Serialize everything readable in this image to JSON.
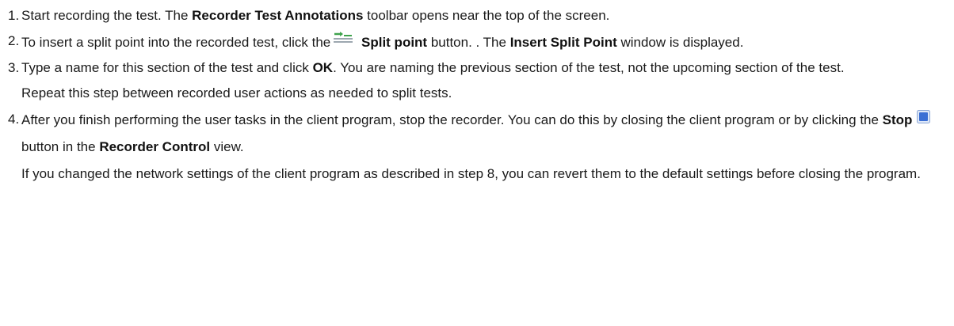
{
  "steps": [
    {
      "num": "1.",
      "parts": {
        "t1": "Start recording the test. The ",
        "b1": "Recorder Test Annotations",
        "t2": " toolbar opens near the top of the screen."
      }
    },
    {
      "num": "2.",
      "parts": {
        "t1": "To insert a split point into the recorded test, click the",
        "icon": "split-point-icon",
        "b1": "Split point",
        "t2": " button. . The ",
        "b2": "Insert Split Point",
        "t3": " window is displayed."
      }
    },
    {
      "num": "3.",
      "parts": {
        "t1": "Type a name for this section of the test and click ",
        "b1": "OK",
        "t2": ". You are naming the previous section of the test, not the upcoming section of the test.",
        "note": "Repeat this step between recorded user actions as needed to split tests."
      }
    },
    {
      "num": "4.",
      "parts": {
        "t1": "After you finish performing the user tasks in the client program, stop the recorder. You can do this by closing the client program or by clicking the ",
        "b1": "Stop",
        "icon": "stop-icon",
        "t2": "button in the ",
        "b2": "Recorder Control",
        "t3": " view.",
        "note": "If you changed the network settings of the client program as described in step 8, you can revert them to the default settings before closing the program."
      }
    }
  ],
  "colors": {
    "text": "#1a1a1a",
    "stop_icon": "#3b6fd4",
    "split_icon_green": "#3fa34d",
    "split_icon_gray": "#7d8a96"
  }
}
